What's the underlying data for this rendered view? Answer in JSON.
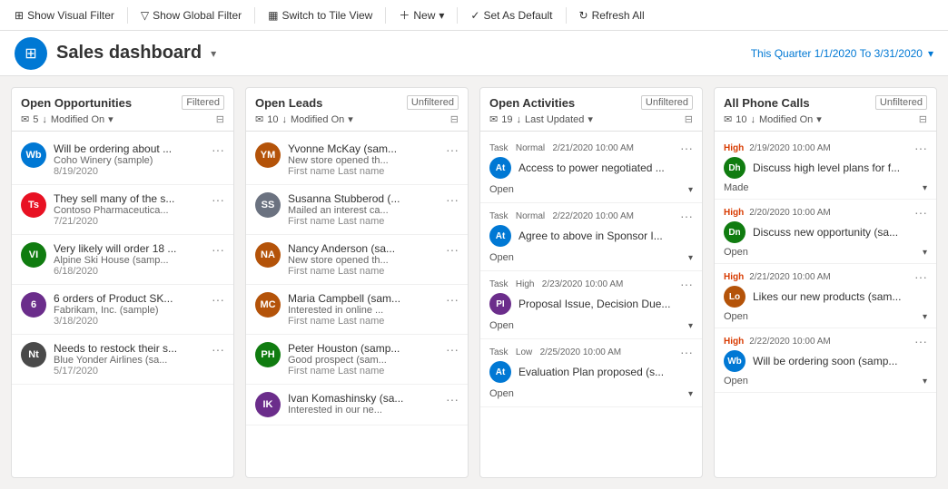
{
  "toolbar": {
    "items": [
      {
        "id": "show-visual-filter",
        "label": "Show Visual Filter",
        "icon": "⊞",
        "interactable": true
      },
      {
        "id": "show-global-filter",
        "label": "Show Global Filter",
        "icon": "▽",
        "interactable": true
      },
      {
        "id": "switch-tile-view",
        "label": "Switch to Tile View",
        "icon": "▦",
        "interactable": true
      },
      {
        "id": "new",
        "label": "New",
        "icon": "+",
        "interactable": true
      },
      {
        "id": "set-default",
        "label": "Set As Default",
        "icon": "✓",
        "interactable": true
      },
      {
        "id": "refresh-all",
        "label": "Refresh All",
        "icon": "↻",
        "interactable": true
      }
    ]
  },
  "header": {
    "title": "Sales dashboard",
    "icon_text": "⊞",
    "date_range": "This Quarter 1/1/2020 To 3/31/2020"
  },
  "columns": [
    {
      "id": "open-opportunities",
      "title": "Open Opportunities",
      "badge": "Filtered",
      "count": "5",
      "sort_label": "Modified On",
      "cards": [
        {
          "initials": "Wb",
          "color": "#0078d4",
          "title": "Will be ordering about ...",
          "sub": "Coho Winery (sample)",
          "date": "8/19/2020"
        },
        {
          "initials": "Ts",
          "color": "#e81123",
          "title": "They sell many of the s...",
          "sub": "Contoso Pharmaceutica...",
          "date": "7/21/2020"
        },
        {
          "initials": "VI",
          "color": "#107c10",
          "title": "Very likely will order 18 ...",
          "sub": "Alpine Ski House (samp...",
          "date": "6/18/2020"
        },
        {
          "initials": "6",
          "color": "#6b2d8b",
          "title": "6 orders of Product SK...",
          "sub": "Fabrikam, Inc. (sample)",
          "date": "3/18/2020"
        },
        {
          "initials": "Nt",
          "color": "#4a4a4a",
          "title": "Needs to restock their s...",
          "sub": "Blue Yonder Airlines (sa...",
          "date": "5/17/2020"
        }
      ]
    },
    {
      "id": "open-leads",
      "title": "Open Leads",
      "badge": "Unfiltered",
      "count": "10",
      "sort_label": "Modified On",
      "cards": [
        {
          "initials": "YM",
          "color": "#b45309",
          "title": "Yvonne McKay (sam...",
          "sub": "New store opened th...",
          "meta": "First name Last name"
        },
        {
          "initials": "SS",
          "color": "#6b7280",
          "title": "Susanna Stubberod (...",
          "sub": "Mailed an interest ca...",
          "meta": "First name Last name"
        },
        {
          "initials": "NA",
          "color": "#b45309",
          "title": "Nancy Anderson (sa...",
          "sub": "New store opened th...",
          "meta": "First name Last name"
        },
        {
          "initials": "MC",
          "color": "#b45309",
          "title": "Maria Campbell (sam...",
          "sub": "Interested in online ...",
          "meta": "First name Last name"
        },
        {
          "initials": "PH",
          "color": "#107c10",
          "title": "Peter Houston (samp...",
          "sub": "Good prospect (sam...",
          "meta": "First name Last name"
        },
        {
          "initials": "IK",
          "color": "#6b2d8b",
          "title": "Ivan Komashinsky (sa...",
          "sub": "Interested in our ne...",
          "meta": ""
        }
      ]
    },
    {
      "id": "open-activities",
      "title": "Open Activities",
      "badge": "Unfiltered",
      "count": "19",
      "sort_label": "Last Updated",
      "activities": [
        {
          "type": "Task",
          "priority": "Normal",
          "datetime": "2/21/2020 10:00 AM",
          "avatar_initials": "At",
          "avatar_color": "#0078d4",
          "desc": "Access to power negotiated ...",
          "status": "Open"
        },
        {
          "type": "Task",
          "priority": "Normal",
          "datetime": "2/22/2020 10:00 AM",
          "avatar_initials": "At",
          "avatar_color": "#0078d4",
          "desc": "Agree to above in Sponsor I...",
          "status": "Open"
        },
        {
          "type": "Task",
          "priority": "High",
          "datetime": "2/23/2020 10:00 AM",
          "avatar_initials": "PI",
          "avatar_color": "#6b2d8b",
          "desc": "Proposal Issue, Decision Due...",
          "status": "Open"
        },
        {
          "type": "Task",
          "priority": "Low",
          "datetime": "2/25/2020 10:00 AM",
          "avatar_initials": "At",
          "avatar_color": "#0078d4",
          "desc": "Evaluation Plan proposed (s...",
          "status": "Open"
        }
      ]
    },
    {
      "id": "all-phone-calls",
      "title": "All Phone Calls",
      "badge": "Unfiltered",
      "count": "10",
      "sort_label": "Modified On",
      "calls": [
        {
          "priority": "High",
          "priority_class": "high",
          "datetime": "2/19/2020 10:00 AM",
          "avatar_initials": "Dh",
          "avatar_color": "#107c10",
          "desc": "Discuss high level plans for f...",
          "status": "Made"
        },
        {
          "priority": "High",
          "priority_class": "high",
          "datetime": "2/20/2020 10:00 AM",
          "avatar_initials": "Dn",
          "avatar_color": "#107c10",
          "desc": "Discuss new opportunity (sa...",
          "status": "Open"
        },
        {
          "priority": "High",
          "priority_class": "high",
          "datetime": "2/21/2020 10:00 AM",
          "avatar_initials": "Lo",
          "avatar_color": "#b45309",
          "desc": "Likes our new products (sam...",
          "status": "Open"
        },
        {
          "priority": "High",
          "priority_class": "high",
          "datetime": "2/22/2020 10:00 AM",
          "avatar_initials": "Wb",
          "avatar_color": "#0078d4",
          "desc": "Will be ordering soon (samp...",
          "status": "Open"
        }
      ]
    }
  ]
}
